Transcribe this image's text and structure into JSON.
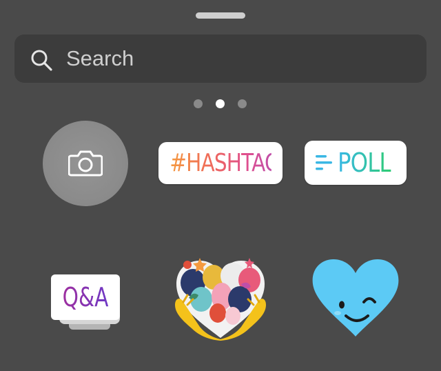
{
  "search": {
    "placeholder": "Search"
  },
  "pager": {
    "page_count": 3,
    "active_index": 1
  },
  "stickers": {
    "camera": {
      "icon": "camera-icon"
    },
    "hashtag": {
      "label": "#HASHTAG"
    },
    "poll": {
      "label": "POLL",
      "icon": "poll-lines-icon"
    },
    "qa": {
      "label": "Q&A"
    },
    "floral_heart": {
      "icon": "floral-heart-sticker"
    },
    "winking_heart": {
      "icon": "winking-heart-sticker"
    }
  },
  "colors": {
    "background": "#4a4a4a",
    "search_bg": "#3c3c3c",
    "hashtag_gradient": [
      "#f59a3e",
      "#e04f8e"
    ],
    "poll_gradient": [
      "#39b8e6",
      "#2ecc71"
    ],
    "qa_color": "#8a2aa6",
    "heart_blue": "#5ccaf5"
  }
}
